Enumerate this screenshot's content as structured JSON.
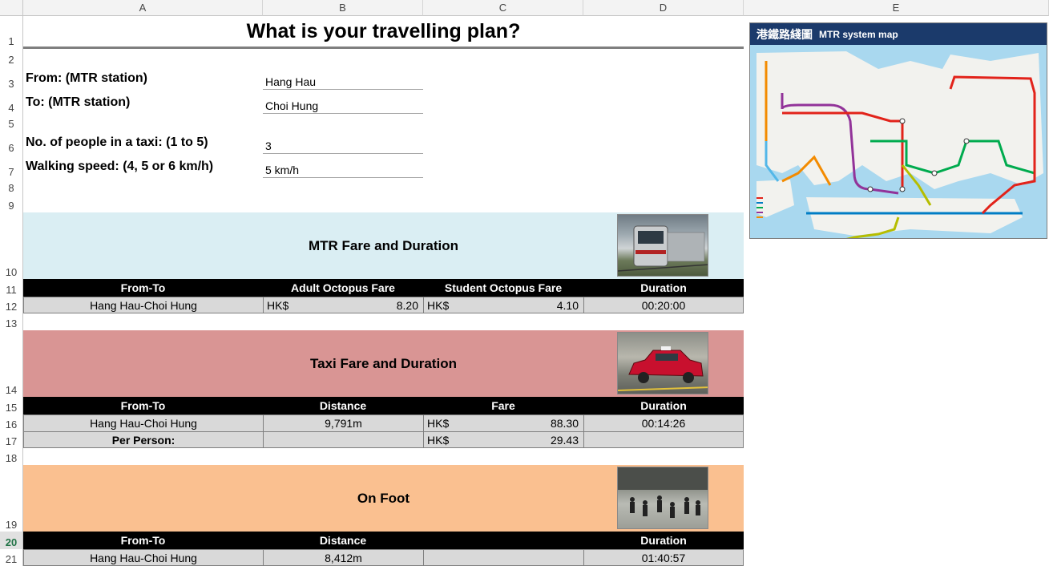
{
  "columns": [
    "A",
    "B",
    "C",
    "D",
    "E"
  ],
  "rows": [
    "1",
    "2",
    "3",
    "4",
    "5",
    "6",
    "7",
    "8",
    "9",
    "10",
    "11",
    "12",
    "13",
    "14",
    "15",
    "16",
    "17",
    "18",
    "19",
    "20",
    "21"
  ],
  "selected_row": "20",
  "sheet": {
    "title": "What is your travelling plan?",
    "from_label": "From: (MTR station)",
    "from_value": "Hang Hau",
    "to_label": "To: (MTR station)",
    "to_value": "Choi Hung",
    "people_label": "No. of people in a taxi: (1 to 5)",
    "people_value": "3",
    "speed_label": "Walking speed: (4, 5 or 6 km/h)",
    "speed_value": "5 km/h"
  },
  "mtr": {
    "heading": "MTR Fare and Duration",
    "headers": [
      "From-To",
      "Adult Octopus Fare",
      "Student Octopus Fare",
      "Duration"
    ],
    "route": "Hang Hau-Choi Hung",
    "adult_currency": "HK$",
    "adult_fare": "8.20",
    "student_currency": "HK$",
    "student_fare": "4.10",
    "duration": "00:20:00"
  },
  "taxi": {
    "heading": "Taxi Fare and Duration",
    "headers": [
      "From-To",
      "Distance",
      "Fare",
      "Duration"
    ],
    "route": "Hang Hau-Choi Hung",
    "distance": "9,791m",
    "fare_currency": "HK$",
    "fare": "88.30",
    "duration": "00:14:26",
    "per_person_label": "Per Person:",
    "per_person_currency": "HK$",
    "per_person_fare": "29.43"
  },
  "foot": {
    "heading": "On Foot",
    "headers": [
      "From-To",
      "Distance",
      "",
      "Duration"
    ],
    "route": "Hang Hau-Choi Hung",
    "distance": "8,412m",
    "duration": "01:40:57"
  },
  "map": {
    "chinese_title": "港鐵路綫圖",
    "english_title": "MTR system map",
    "header_color": "#1b3a6b",
    "water_color": "#a9d8ef",
    "line_colors": [
      "#e2231a",
      "#007dc5",
      "#00ab4e",
      "#923399",
      "#f38b00",
      "#53b7e8",
      "#b6bd00"
    ]
  },
  "colors": {
    "mtr_band": "#daeef3",
    "taxi_band": "#d99594",
    "foot_band": "#fac090",
    "table_header": "#000000",
    "cell_bg": "#d9d9d9"
  }
}
